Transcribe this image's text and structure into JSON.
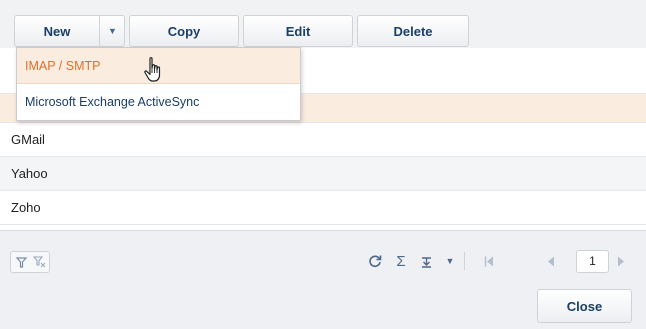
{
  "toolbar": {
    "new_label": "New",
    "copy_label": "Copy",
    "edit_label": "Edit",
    "delete_label": "Delete"
  },
  "dropdown": {
    "items": [
      {
        "label": "IMAP / SMTP"
      },
      {
        "label": "Microsoft Exchange ActiveSync"
      }
    ]
  },
  "grid": {
    "rows": [
      {
        "name": ""
      },
      {
        "name": "GMail"
      },
      {
        "name": "Yahoo"
      },
      {
        "name": "Zoho"
      }
    ]
  },
  "footer": {
    "page_number": "1",
    "close_label": "Close"
  },
  "colors": {
    "accent_orange": "#e0702a",
    "selected_row": "#fbece0",
    "button_text": "#1a3f68"
  },
  "icons": {
    "filter": "filter-icon",
    "clear_filter": "clear-filter-icon",
    "refresh": "refresh-icon",
    "sum": "sum-icon",
    "export": "export-icon",
    "more": "chevron-down-icon",
    "first_page": "first-page-icon",
    "prev_page": "prev-page-icon",
    "next_page": "next-page-icon",
    "cursor": "hand-cursor-icon"
  }
}
